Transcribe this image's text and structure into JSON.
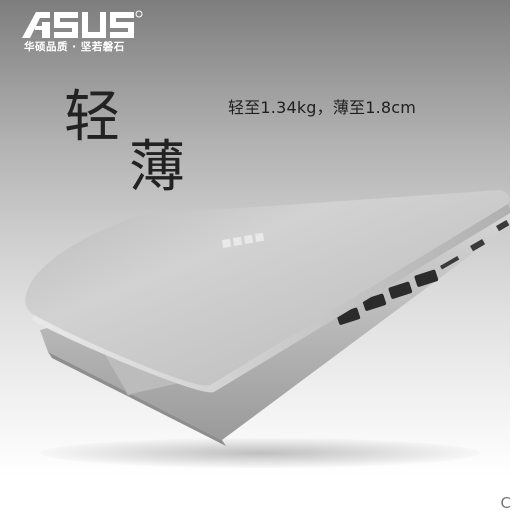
{
  "brand": {
    "logo_text": "ASUS",
    "slogan": "华硕品质 · 坚若磐石"
  },
  "headline": {
    "char_1": "轻",
    "char_2": "薄"
  },
  "tagline": "轻至1.34kg，薄至1.8cm",
  "product": {
    "name": "ASUS laptop (closed lid, silver)"
  },
  "colors": {
    "background_top": "#7d7d7d",
    "background_bottom": "#ffffff",
    "lid_silver": "#c9c9c9",
    "text_dark": "#1f1f1f",
    "logo_white": "#ffffff"
  },
  "corner_mark": "C"
}
